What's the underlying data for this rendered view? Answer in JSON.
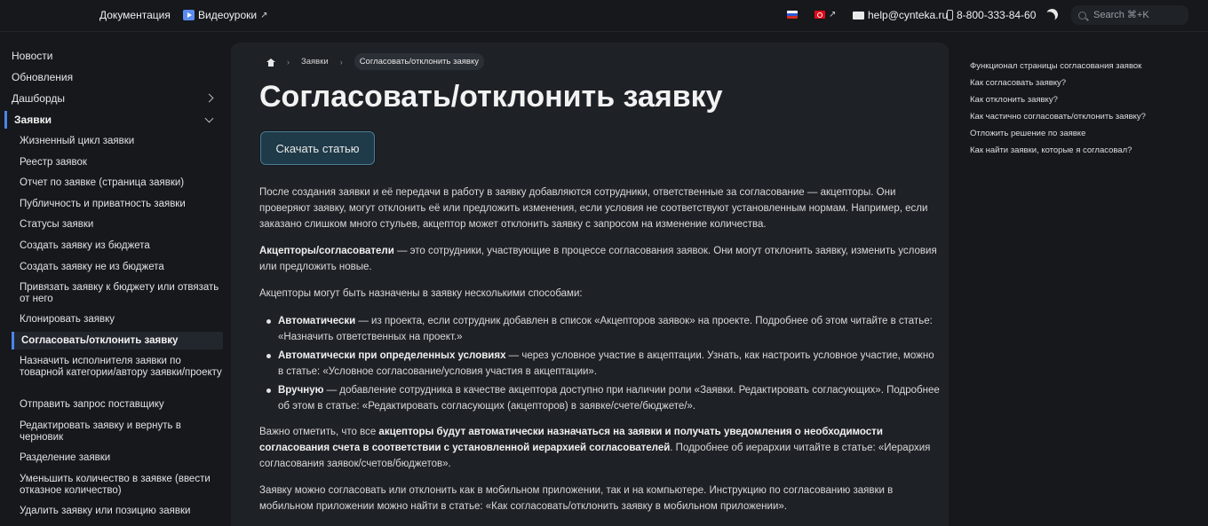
{
  "header": {
    "docs_label": "Документация",
    "video_label": "Видеоуроки",
    "email": "help@cynteka.ru",
    "phone": "8-800-333-84-60",
    "search_placeholder": "Search ⌘+K"
  },
  "sidebar": {
    "top_items": [
      "Новости",
      "Обновления",
      "Дашборды",
      "Заявки"
    ],
    "sub_items": [
      "Жизненный цикл заявки",
      "Реестр заявок",
      "Отчет по заявке (страница заявки)",
      "Публичность и приватность заявки",
      "Статусы заявки",
      "Создать заявку из бюджета",
      "Создать заявку не из бюджета",
      "Привязать заявку к бюджету или отвязать от него",
      "Клонировать заявку",
      "Согласовать/отклонить заявку",
      "Назначить исполнителя заявки по товарной категории/автору заявки/проекту",
      "Отправить запрос поставщику",
      "Редактировать заявку и вернуть в черновик",
      "Разделение заявки",
      "Уменьшить количество в заявке (ввести отказное количество)",
      "Удалить заявку или позицию заявки"
    ]
  },
  "breadcrumb": {
    "section": "Заявки",
    "current": "Согласовать/отклонить заявку"
  },
  "page": {
    "title": "Согласовать/отклонить заявку",
    "download_label": "Скачать статью",
    "p1": "После создания заявки и её передачи в работу в заявку добавляются сотрудники, ответственные за согласование — акцепторы. Они проверяют заявку, могут отклонить её или предложить изменения, если условия не соответствуют установленным нормам. Например, если заказано слишком много стульев, акцептор может отклонить заявку с запросом на изменение количества.",
    "p2_bold": "Акцепторы/согласователи",
    "p2_rest": " — это сотрудники, участвующие в процессе согласования заявок. Они могут отклонить заявку, изменить условия или предложить новые.",
    "p3": "Акцепторы могут быть назначены в заявку несколькими способами:",
    "li1_bold": "Автоматически",
    "li1_rest": " — из проекта, если сотрудник добавлен в список «Акцепторов заявок» на проекте. Подробнее об этом читайте в статье: «Назначить ответственных на проект.»",
    "li2_bold": "Автоматически при определенных условиях",
    "li2_rest": " — через условное участие в акцептации. Узнать, как настроить условное участие, можно в статье: «Условное согласование/условия участия в акцептации».",
    "li3_bold": "Вручную",
    "li3_rest": " — добавление сотрудника в качестве акцептора доступно при наличии роли «Заявки. Редактировать согласующих». Подробнее об этом в статье: «Редактировать согласующих (акцепторов) в заявке/счете/бюджете/».",
    "p4_start": "Важно отметить, что все ",
    "p4_bold": "акцепторы будут автоматически назначаться на заявки и получать уведомления о необходимости согласования счета в соответствии с установленной иерархией согласователей",
    "p4_rest": ". Подробнее об иерархии читайте в статье: «Иерархия согласования заявок/счетов/бюджетов».",
    "p5": "Заявку можно согласовать или отклонить как в мобильном приложении, так и на компьютере. Инструкцию по согласованию заявки в мобильном приложении можно найти в статье: «Как согласовать/отклонить заявку в мобильном приложении»."
  },
  "toc": [
    "Функционал страницы согласования заявок",
    "Как согласовать заявку?",
    "Как отклонить заявку?",
    "Как частично согласовать/отклонить заявку?",
    "Отложить решение по заявке",
    "Как найти заявки, которые я согласовал?"
  ],
  "colors": {
    "background": "#16181c",
    "panel": "#1e2126",
    "accent": "#4a86e8",
    "button_bg": "#1f3a48",
    "button_border": "#4c7d92"
  }
}
